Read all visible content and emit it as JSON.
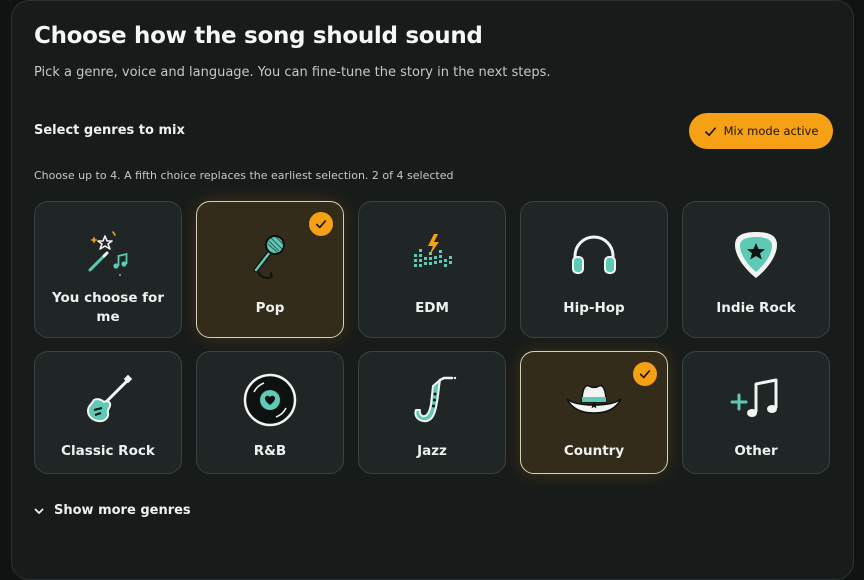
{
  "header": {
    "title": "Choose how the song should sound",
    "subtitle": "Pick a genre, voice and language. You can fine-tune the story in the next steps."
  },
  "genres_section": {
    "label": "Select genres to mix",
    "mix_button_label": "Mix mode active",
    "hint": "Choose up to 4. A fifth choice replaces the earliest selection. 2 of 4 selected",
    "items": [
      {
        "label": "You choose for me",
        "icon": "magic-wand-icon",
        "selected": false
      },
      {
        "label": "Pop",
        "icon": "microphone-icon",
        "selected": true
      },
      {
        "label": "EDM",
        "icon": "equalizer-icon",
        "selected": false
      },
      {
        "label": "Hip-Hop",
        "icon": "headphones-icon",
        "selected": false
      },
      {
        "label": "Indie Rock",
        "icon": "guitar-pick-icon",
        "selected": false
      },
      {
        "label": "Classic Rock",
        "icon": "electric-guitar-icon",
        "selected": false
      },
      {
        "label": "R&B",
        "icon": "vinyl-record-icon",
        "selected": false
      },
      {
        "label": "Jazz",
        "icon": "saxophone-icon",
        "selected": false
      },
      {
        "label": "Country",
        "icon": "cowboy-hat-icon",
        "selected": true
      },
      {
        "label": "Other",
        "icon": "plus-music-note-icon",
        "selected": false
      }
    ],
    "show_more_label": "Show more genres"
  },
  "colors": {
    "accent": "#f5a015",
    "teal": "#5ec9b4",
    "card_bg": "#1f2625",
    "selected_bg": "#342c1a",
    "panel_bg": "#171b1a"
  }
}
